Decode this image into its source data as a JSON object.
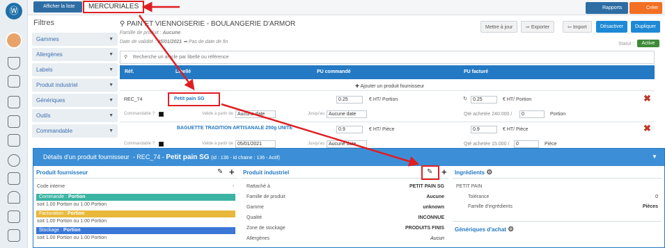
{
  "header": {
    "list_btn": "Afficher la liste",
    "mercuriales": "MERCURIALES",
    "rapports": "Rapports",
    "creer": "Créer"
  },
  "filters": {
    "title": "Filtres",
    "items": [
      "Gammes",
      "Allergènes",
      "Labels",
      "Produit industriel",
      "Génériques",
      "Outils",
      "Commandable"
    ]
  },
  "product": {
    "title": "PAIN ET VIENNOISERIE - BOULANGERIE D'ARMOR",
    "famille_label": "Famille de produit :",
    "famille_value": "Aucune",
    "date_label": "Date de validité :",
    "date_value": "05/01/2021",
    "date_end": "Pas de date de fin",
    "statut_label": "Statut :",
    "statut_value": "Active"
  },
  "toolbar": {
    "mettre_a_jour": "Mettre à jour",
    "exporter": "Exporter",
    "import": "Import",
    "desactiver": "Désactiver",
    "dupliquer": "Dupliquer"
  },
  "search": {
    "placeholder": "Recherche un article par libellé ou référence"
  },
  "table": {
    "headers": {
      "ref": "Réf.",
      "libelle": "Libellé",
      "pu_commande": "PU commandé",
      "pu_facture": "PU facturé"
    },
    "add_supplier": "Ajouter un produit fournisseur",
    "rows": [
      {
        "ref": "REC_74",
        "libelle": "Petit pain SG",
        "commandable": "Commandable ?",
        "valide_label": "Valide à partir de",
        "valide_value": "Aucune date",
        "jusqu_label": "Jusqu'au",
        "jusqu_value": "Aucune date",
        "pu_cmd": "0.25",
        "pu_cmd_unit": "€ HT/ Portion",
        "pu_fact": "0.25",
        "pu_fact_unit": "€ HT/ Portion",
        "qte_label": "Qté achetée 240.000 /",
        "qte_value": "0",
        "qte_unit": "Portion"
      },
      {
        "ref": "",
        "libelle": "BAGUETTE TRADITION ARTISANALE 250g UNITE",
        "commandable": "Commandable ?",
        "valide_label": "Valide à partir de",
        "valide_value": "05/01/2021",
        "jusqu_label": "Jusqu'au",
        "jusqu_value": "Aucune date",
        "pu_cmd": "0.9",
        "pu_cmd_unit": "€ HT/ Pièce",
        "pu_fact": "0.9",
        "pu_fact_unit": "€ HT/ Pièce",
        "qte_label": "Qté achetée 15.000 /",
        "qte_value": "0",
        "qte_unit": "Pièce"
      }
    ]
  },
  "details": {
    "title_prefix": "Détails d'un produit fournisseur",
    "title_ref": "- REC_74 -",
    "title_name": "Petit pain SG",
    "title_meta": "(id : 136 - id chaine : 136 - Actif)",
    "fournisseur": {
      "title": "Produit fournisseur",
      "code": "Code interne",
      "code_value": "-",
      "commande": "Commande :",
      "commande_unit": "Portion",
      "commande_line": "soit 1.00 Portion ou 1.00 Portion",
      "facturation": "Facturation :",
      "facturation_unit": "Portion",
      "facturation_line": "soit 1.00 Portion ou 1.00 Portion",
      "stockage": "Stockage :",
      "stockage_unit": "Portion",
      "stockage_line": "soit 1.00 Portion ou 1.00 Portion"
    },
    "industriel": {
      "title": "Produit industriel",
      "rows": [
        [
          "Rattaché à",
          "PETIT PAIN SG"
        ],
        [
          "Famille de produit",
          "Aucune"
        ],
        [
          "Gamme",
          "unknown"
        ],
        [
          "Qualité",
          "INCONNUE"
        ],
        [
          "Zone de stockage",
          "PRODUITS FINIS"
        ],
        [
          "Allergènes",
          "Aucun"
        ]
      ]
    },
    "ingredients": {
      "title": "Ingrédients",
      "name": "PETIT PAIN",
      "tolerance": "Tolérance",
      "tolerance_value": "0",
      "famille": "Famille d'ingrédients",
      "famille_value": "Pièces",
      "generiques": "Génériques d'achat"
    }
  },
  "colors": {
    "accent": "#2479c4",
    "orange": "#f36f21",
    "red": "#e01e22",
    "green": "#3d8b37"
  }
}
